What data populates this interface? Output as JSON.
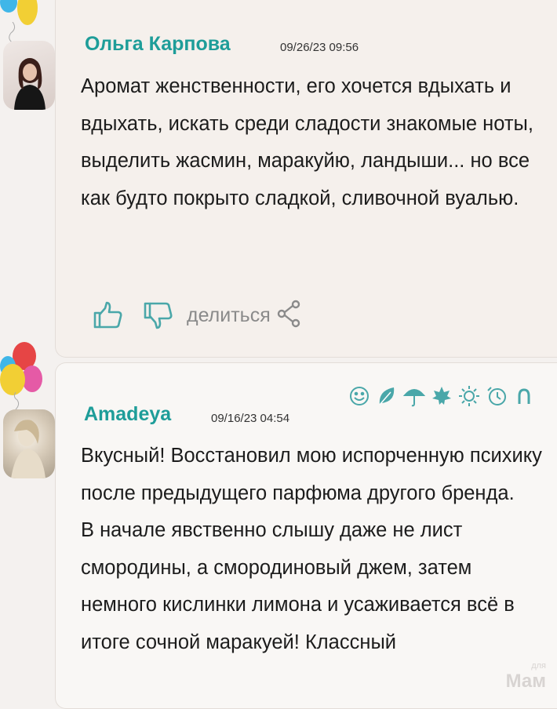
{
  "comments": [
    {
      "author": "Ольга Карпова",
      "date": "09/26/23 09:56",
      "text": [
        "Аромат женственности, его хочется вдыхать и вдыхать, искать среди сладости знакомые ноты, выделить жасмин, маракуйю, ландыши... но все как будто покрыто сладкой, сливочной вуалью."
      ],
      "actions": {
        "like_icon": "thumbs-up-icon",
        "dislike_icon": "thumbs-down-icon",
        "share_label": "делиться",
        "share_icon": "share-icon"
      }
    },
    {
      "author": "Amadeya",
      "date": "09/16/23 04:54",
      "text": [
        "Вкусный! Восстановил мою испорченную психику после предыдущего парфюма другого бренда.",
        "В начале явственно слышу даже не лист смородины, а смородиновый джем, затем немного кислинки лимона и усаживается всё в итоге сочной маракуей! Классный"
      ],
      "mood_icons": [
        "smile-icon",
        "leaf-icon",
        "umbrella-icon",
        "maple-leaf-icon",
        "sun-icon",
        "clock-icon",
        "horseshoe-icon"
      ]
    }
  ],
  "watermark": {
    "small": "для",
    "big": "Мам"
  },
  "colors": {
    "author": "#1e9d99",
    "icons": "#4aa7a9",
    "share": "#8a8a8a"
  }
}
